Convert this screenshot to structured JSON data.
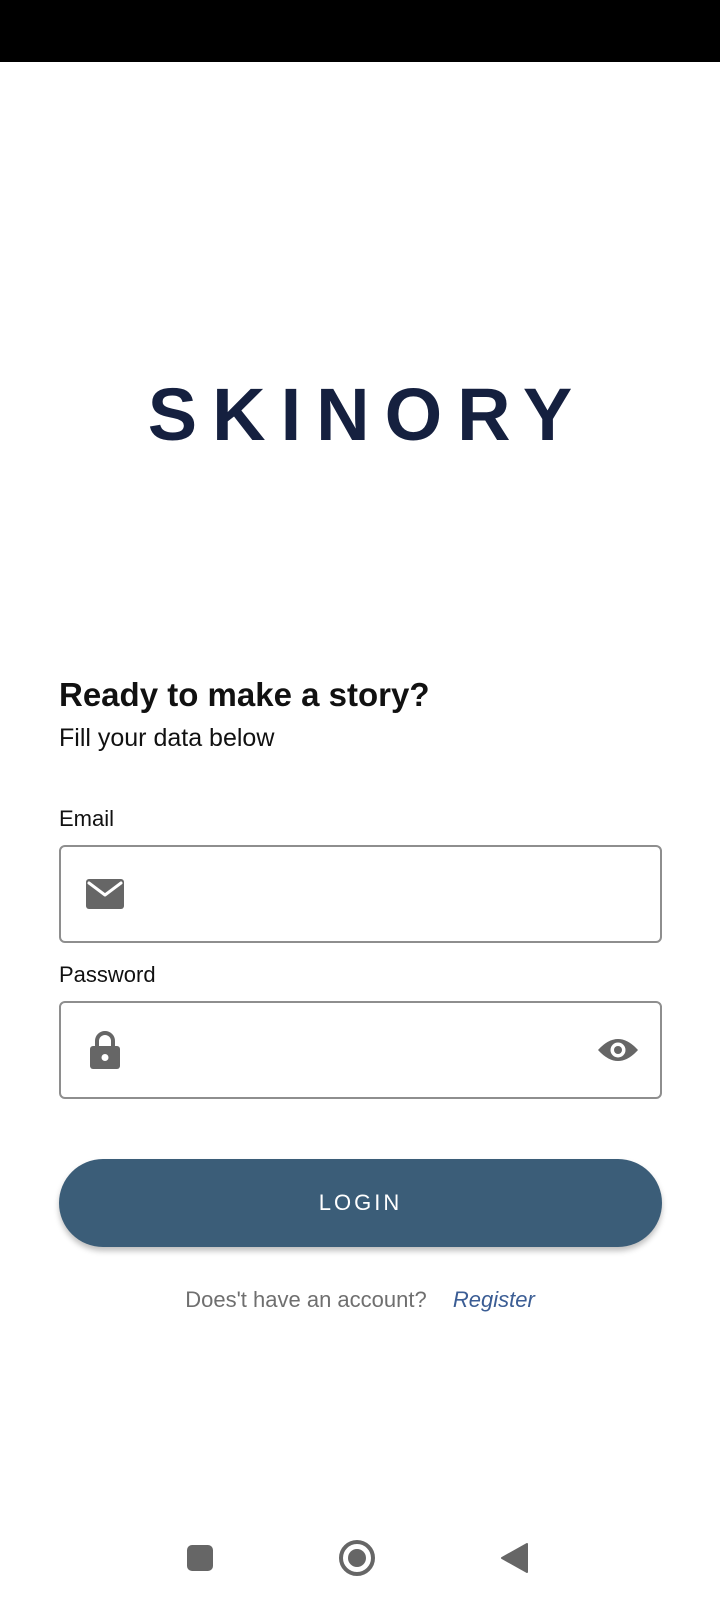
{
  "app": {
    "logo_text": "SKINORY"
  },
  "login": {
    "heading": "Ready to make a story?",
    "subheading": "Fill your data below",
    "email": {
      "label": "Email",
      "value": "",
      "icon": "mail-icon"
    },
    "password": {
      "label": "Password",
      "value": "",
      "icon": "lock-icon",
      "toggle_icon": "eye-icon"
    },
    "login_button_label": "LOGIN",
    "register_question": "Does't have an account?",
    "register_link": "Register"
  },
  "navigation": {
    "recents_icon": "square-icon",
    "home_icon": "circle-home-icon",
    "back_icon": "triangle-back-icon"
  },
  "colors": {
    "brand": "#15203f",
    "button": "#3b5d78",
    "link": "#3b5d94",
    "icon": "#666666"
  }
}
